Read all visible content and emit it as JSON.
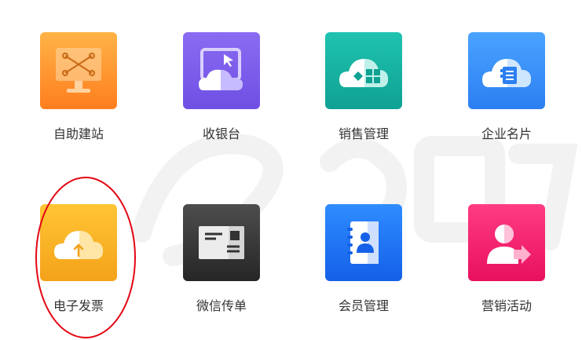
{
  "apps": [
    {
      "label": "自助建站",
      "icon": "website-builder-icon",
      "color_top": "#ffb347",
      "color_bottom": "#ff7e1e"
    },
    {
      "label": "收银台",
      "icon": "cashier-icon",
      "color_top": "#8a6cf2",
      "color_bottom": "#6f4fe3"
    },
    {
      "label": "销售管理",
      "icon": "sales-management-icon",
      "color_top": "#20c3b0",
      "color_bottom": "#0fa192"
    },
    {
      "label": "企业名片",
      "icon": "business-card-icon",
      "color_top": "#4aa3ff",
      "color_bottom": "#2c7ff2"
    },
    {
      "label": "电子发票",
      "icon": "e-invoice-icon",
      "color_top": "#ffc534",
      "color_bottom": "#f4a21a"
    },
    {
      "label": "微信传单",
      "icon": "wechat-flyer-icon",
      "color_top": "#4d4d4d",
      "color_bottom": "#262626"
    },
    {
      "label": "会员管理",
      "icon": "member-management-icon",
      "color_top": "#2f8cff",
      "color_bottom": "#1460e8"
    },
    {
      "label": "营销活动",
      "icon": "marketing-activity-icon",
      "color_top": "#ff3c83",
      "color_bottom": "#e8105f"
    }
  ],
  "annotation": {
    "color": "#e30613"
  }
}
